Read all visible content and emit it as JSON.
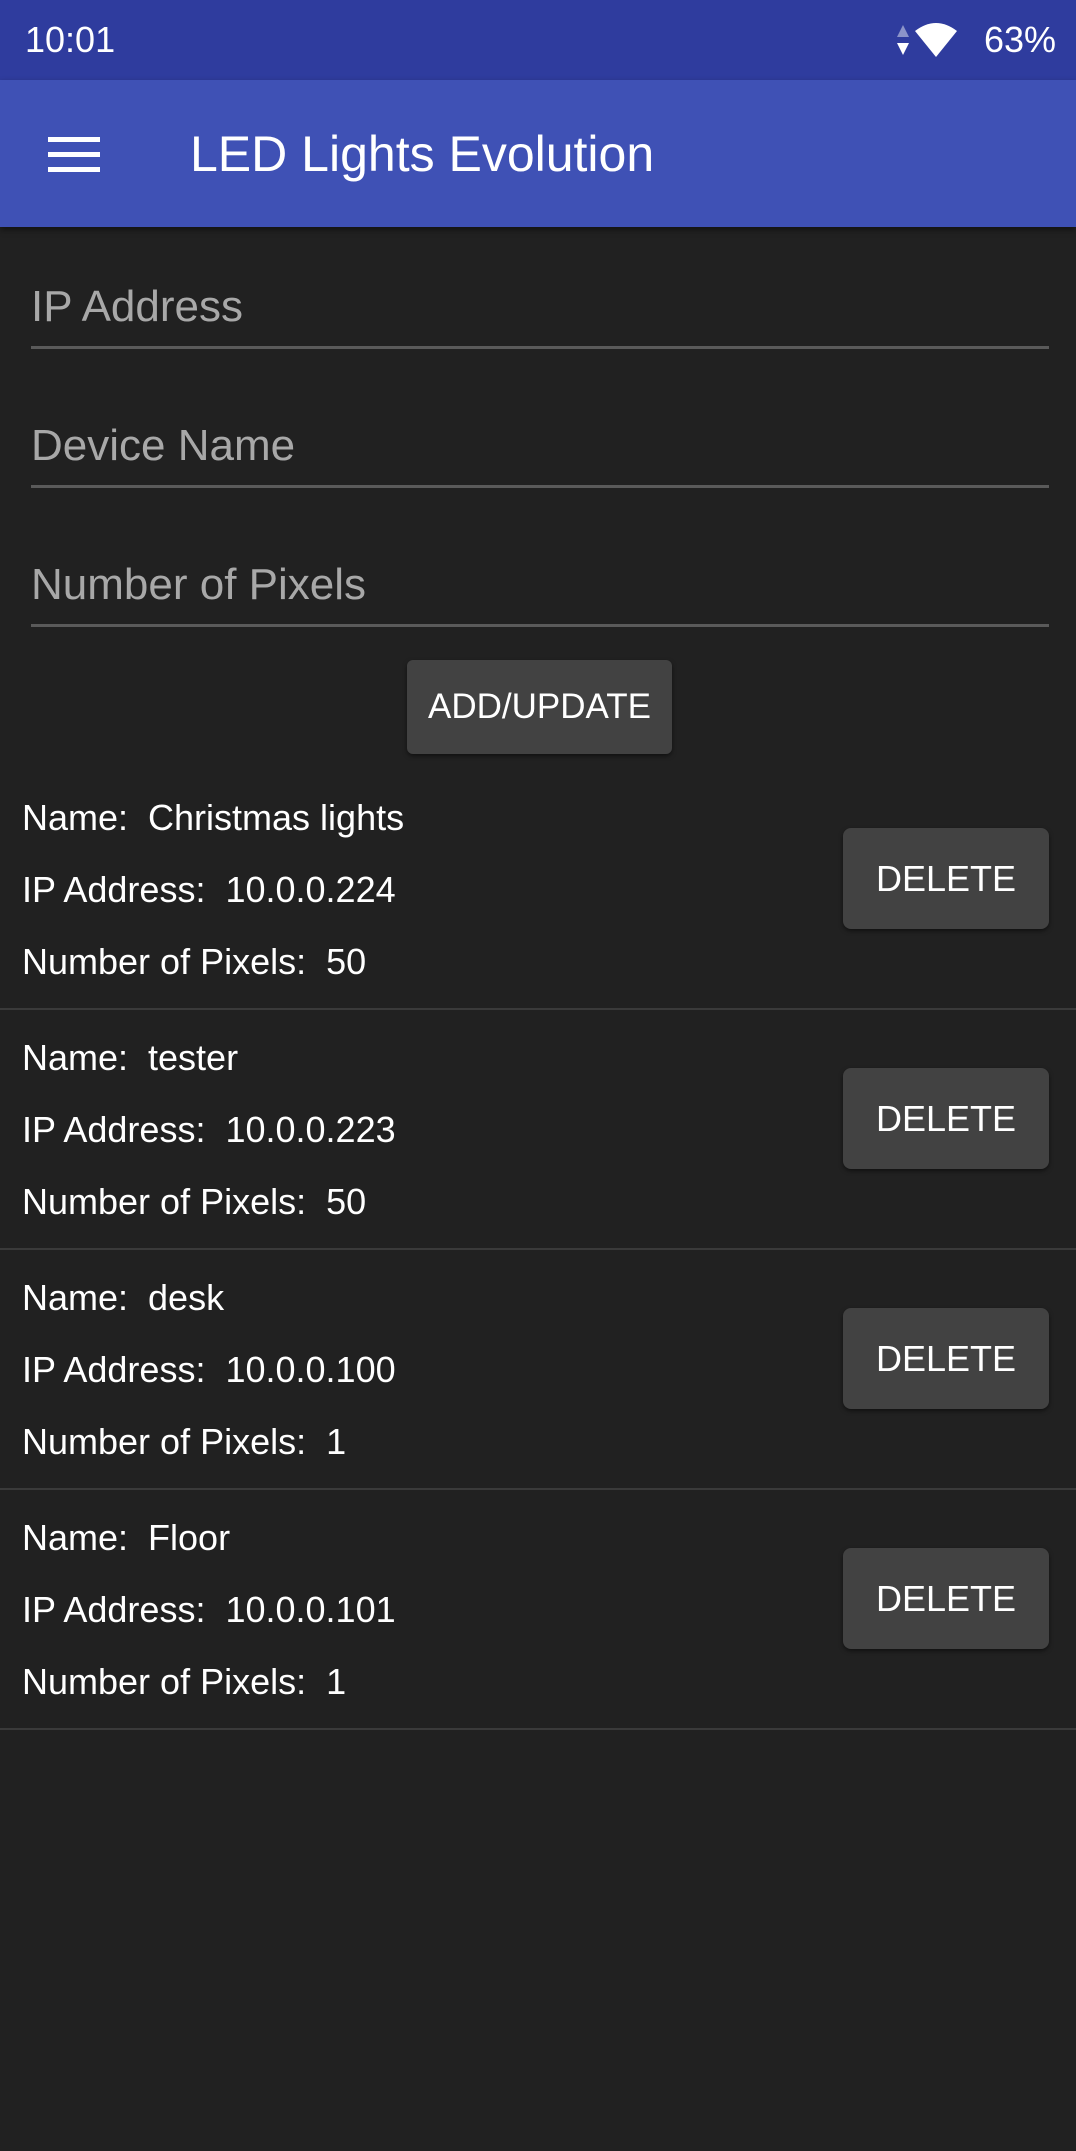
{
  "status_bar": {
    "time": "10:01",
    "battery": "63%",
    "icons": [
      "data-arrows-icon",
      "wifi-icon"
    ]
  },
  "app_bar": {
    "title": "LED Lights Evolution",
    "menu_icon": "hamburger-menu-icon"
  },
  "form": {
    "ip_placeholder": "IP Address",
    "name_placeholder": "Device Name",
    "pixels_placeholder": "Number of Pixels",
    "ip_value": "",
    "name_value": "",
    "pixels_value": "",
    "add_label": "ADD/UPDATE"
  },
  "labels": {
    "name": "Name:",
    "ip": "IP Address:",
    "pixels": "Number of Pixels:"
  },
  "devices": [
    {
      "name": "Christmas lights",
      "ip": "10.0.0.224",
      "pixels": "50",
      "delete_label": "DELETE"
    },
    {
      "name": "tester",
      "ip": "10.0.0.223",
      "pixels": "50",
      "delete_label": "DELETE"
    },
    {
      "name": "desk",
      "ip": "10.0.0.100",
      "pixels": "1",
      "delete_label": "DELETE"
    },
    {
      "name": "Floor",
      "ip": "10.0.0.101",
      "pixels": "1",
      "delete_label": "DELETE"
    }
  ],
  "colors": {
    "status_bar": "#2f3c9e",
    "app_bar": "#3f51b5",
    "background": "#212121",
    "button": "#424242"
  }
}
